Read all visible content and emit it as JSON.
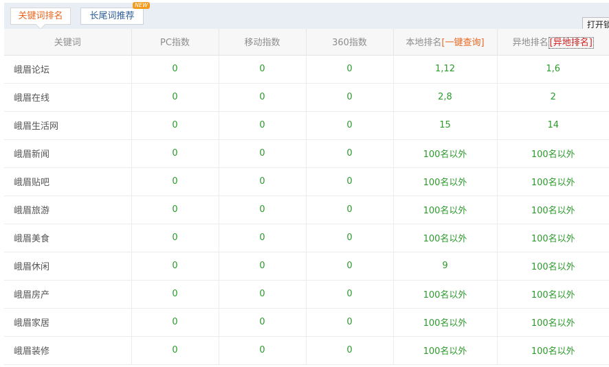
{
  "tabs": {
    "keyword_rank": "关键词排名",
    "long_tail": "长尾词推荐",
    "new_badge": "NEW"
  },
  "open_button": "打开锁",
  "table": {
    "headers": {
      "keyword": "关键词",
      "pc_index": "PC指数",
      "mobile_index": "移动指数",
      "index_360": "360指数",
      "local_rank": "本地排名",
      "local_query": "[一键查询]",
      "remote_rank": "异地排名",
      "remote_query": "[异地排名]"
    },
    "rows": [
      {
        "keyword": "峨眉论坛",
        "pc": "0",
        "mobile": "0",
        "i360": "0",
        "local": "1,12",
        "remote": "1,6"
      },
      {
        "keyword": "峨眉在线",
        "pc": "0",
        "mobile": "0",
        "i360": "0",
        "local": "2,8",
        "remote": "2"
      },
      {
        "keyword": "峨眉生活网",
        "pc": "0",
        "mobile": "0",
        "i360": "0",
        "local": "15",
        "remote": "14"
      },
      {
        "keyword": "峨眉新闻",
        "pc": "0",
        "mobile": "0",
        "i360": "0",
        "local": "100名以外",
        "remote": "100名以外"
      },
      {
        "keyword": "峨眉贴吧",
        "pc": "0",
        "mobile": "0",
        "i360": "0",
        "local": "100名以外",
        "remote": "100名以外"
      },
      {
        "keyword": "峨眉旅游",
        "pc": "0",
        "mobile": "0",
        "i360": "0",
        "local": "100名以外",
        "remote": "100名以外"
      },
      {
        "keyword": "峨眉美食",
        "pc": "0",
        "mobile": "0",
        "i360": "0",
        "local": "100名以外",
        "remote": "100名以外"
      },
      {
        "keyword": "峨眉休闲",
        "pc": "0",
        "mobile": "0",
        "i360": "0",
        "local": "9",
        "remote": "100名以外"
      },
      {
        "keyword": "峨眉房产",
        "pc": "0",
        "mobile": "0",
        "i360": "0",
        "local": "100名以外",
        "remote": "100名以外"
      },
      {
        "keyword": "峨眉家居",
        "pc": "0",
        "mobile": "0",
        "i360": "0",
        "local": "100名以外",
        "remote": "100名以外"
      },
      {
        "keyword": "峨眉装修",
        "pc": "0",
        "mobile": "0",
        "i360": "0",
        "local": "100名以外",
        "remote": "100名以外"
      }
    ]
  },
  "colors": {
    "accent_orange": "#e8661f",
    "value_green": "#2a9a2a",
    "link_blue": "#2d5f99",
    "query_red": "#d42020"
  }
}
